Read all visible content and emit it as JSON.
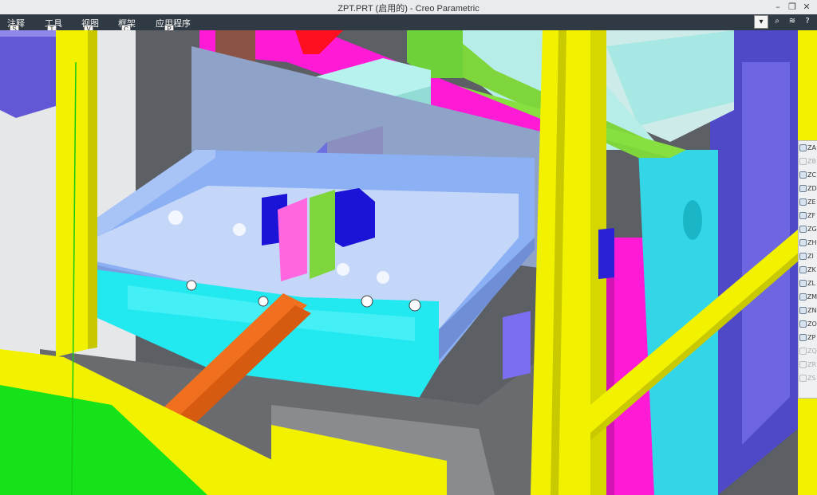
{
  "window": {
    "title": "ZPT.PRT (启用的) - Creo Parametric",
    "controls": [
      "–",
      "❐",
      "✕"
    ]
  },
  "ribbon": {
    "tabs": [
      {
        "label": "注释",
        "key": "S"
      },
      {
        "label": "工具",
        "key": "T"
      },
      {
        "label": "视图",
        "key": "V"
      },
      {
        "label": "框架",
        "key": "C"
      },
      {
        "label": "应用程序",
        "key": "P"
      }
    ],
    "tools": {
      "dropdown": "▾",
      "search": "⌕",
      "settings": "≋",
      "help": "?"
    }
  },
  "side_panel": {
    "items": [
      {
        "label": "ZA",
        "enabled": true
      },
      {
        "label": "ZB",
        "enabled": false
      },
      {
        "label": "ZC",
        "enabled": true
      },
      {
        "label": "ZD",
        "enabled": true
      },
      {
        "label": "ZE",
        "enabled": true
      },
      {
        "label": "ZF",
        "enabled": true
      },
      {
        "label": "ZG",
        "enabled": true
      },
      {
        "label": "ZH",
        "enabled": true
      },
      {
        "label": "ZI",
        "enabled": true
      },
      {
        "label": "ZK",
        "enabled": true
      },
      {
        "label": "ZL",
        "enabled": true
      },
      {
        "label": "ZM",
        "enabled": true
      },
      {
        "label": "ZN",
        "enabled": true
      },
      {
        "label": "ZO",
        "enabled": true
      },
      {
        "label": "ZP",
        "enabled": true
      },
      {
        "label": "ZQ",
        "enabled": false
      },
      {
        "label": "ZR",
        "enabled": false
      },
      {
        "label": "ZS",
        "enabled": false
      }
    ]
  },
  "colors": {
    "frame_yellow": "#f2f200",
    "tray_blue": "#8fb0f2",
    "base_cyan": "#22e8f0",
    "rail_orange": "#f07020",
    "floor_green": "#16e21a",
    "block_purple": "#6a5ed6",
    "pink": "#ff1ad6",
    "pale_cyan": "#b8f2ee"
  }
}
